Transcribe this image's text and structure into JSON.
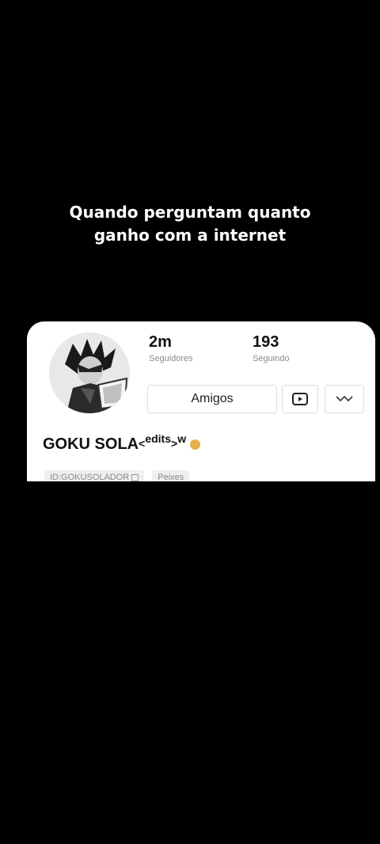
{
  "caption": {
    "line1": "Quando perguntam quanto",
    "line2": "ganho com a internet"
  },
  "profile": {
    "followers_count": "2m",
    "followers_label": "Seguidores",
    "following_count": "193",
    "following_label": "Seguindo",
    "friends_button": "Amigos",
    "name": "GOKU SOLA",
    "name_suffix_lt": "<",
    "name_suffix_sup": "edits",
    "name_suffix_gt": ">",
    "name_suffix_w": "w",
    "id_tag": "ID:GOKUSOLADOR",
    "zodiac_tag": "Peixes"
  },
  "colors": {
    "background": "#000000",
    "card": "#ffffff",
    "badge": "#e3b04b"
  },
  "icons": {
    "video": "play-square-icon",
    "more": "chevron-down-double-icon",
    "badge": "verified-badge-icon",
    "copy": "copy-icon"
  }
}
